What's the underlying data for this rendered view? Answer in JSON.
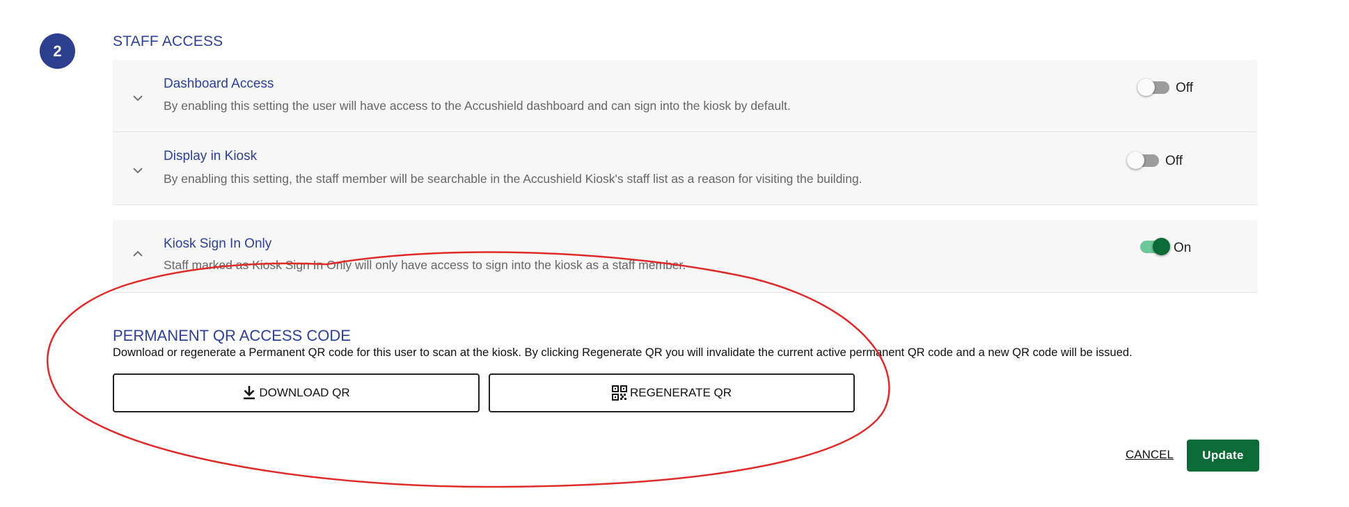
{
  "step": {
    "number": "2"
  },
  "staff_access": {
    "title": "STAFF ACCESS",
    "items": [
      {
        "title": "Dashboard Access",
        "description": "By enabling this setting the user will have access to the Accushield dashboard and can sign into the kiosk by default.",
        "toggle_state": "Off",
        "expanded": false
      },
      {
        "title": "Display in Kiosk",
        "description": "By enabling this setting, the staff member will be searchable in the Accushield Kiosk's staff list as a reason for visiting the building.",
        "toggle_state": "Off",
        "expanded": false
      },
      {
        "title": "Kiosk Sign In Only",
        "description": "Staff marked as Kiosk Sign In Only will only have access to sign into the kiosk as a staff member.",
        "toggle_state": "On",
        "expanded": true
      }
    ]
  },
  "qr_section": {
    "title": "PERMANENT QR ACCESS CODE",
    "description": "Download or regenerate a Permanent QR code for this user to scan at the kiosk. By clicking Regenerate QR you will invalidate the current active permanent QR code and a new QR code will be issued.",
    "download_label": "DOWNLOAD QR",
    "regenerate_label": "REGENERATE QR"
  },
  "actions": {
    "cancel_label": "CANCEL",
    "update_label": "Update"
  },
  "colors": {
    "accent_blue": "#2c4197",
    "badge_blue": "#2d3f8f",
    "primary_green": "#0b6b34",
    "toggle_on_track": "#6cc79a",
    "annotation_red": "#e02a2a"
  },
  "icons": {
    "collapsed": "chevron-down-icon",
    "expanded": "chevron-up-icon",
    "download": "download-icon",
    "regenerate": "qr-code-icon"
  }
}
